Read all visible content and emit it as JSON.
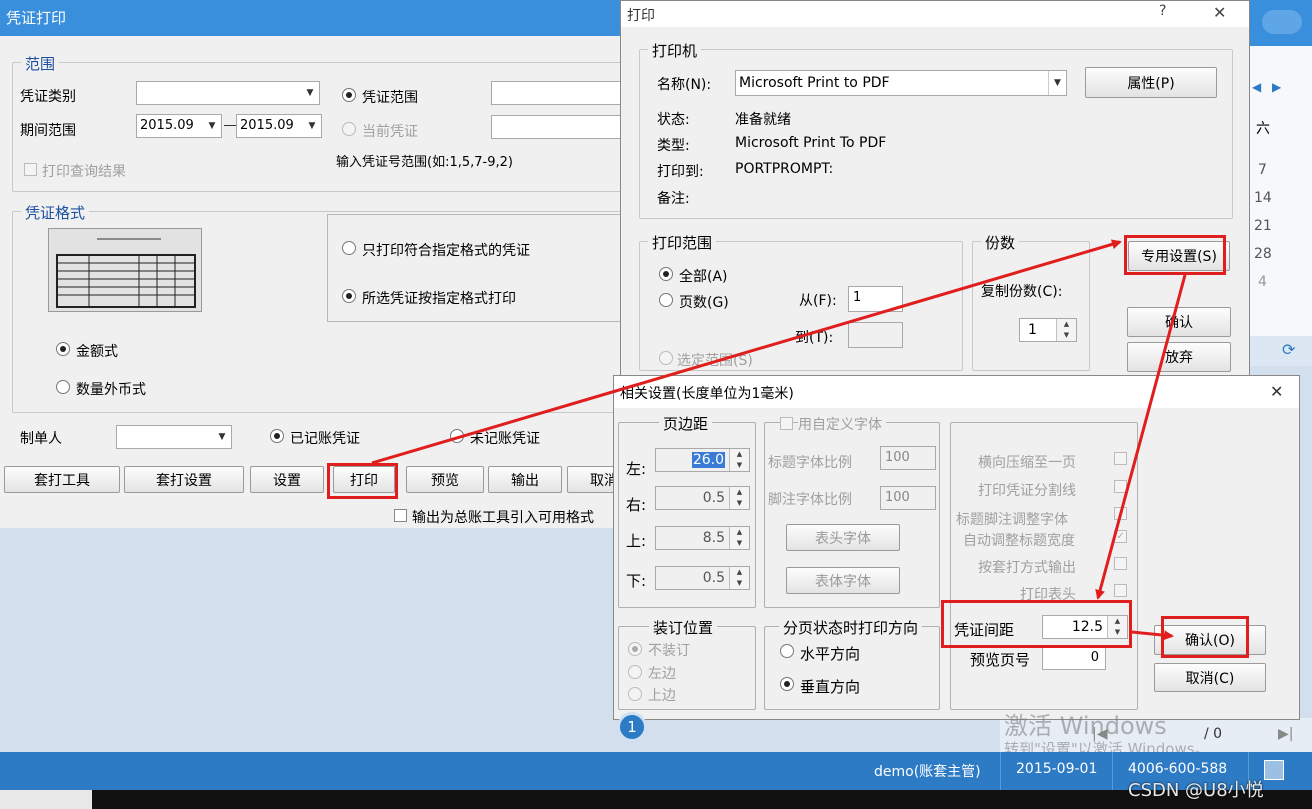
{
  "voucher_window": {
    "title": "凭证打印",
    "range_group": "范围",
    "voucher_type_label": "凭证类别",
    "period_label": "期间范围",
    "period_from": "2015.09",
    "period_to": "2015.09",
    "print_query_result": "打印查询结果",
    "voucher_range_radio": "凭证范围",
    "current_voucher_radio": "当前凭证",
    "voucher_range_hint": "输入凭证号范围(如:1,5,7-9,2)",
    "format_group": "凭证格式",
    "format_option1": "只打印符合指定格式的凭证",
    "format_option2": "所选凭证按指定格式打印",
    "amount_format": "金额式",
    "qty_format": "数量外币式",
    "maker_label": "制单人",
    "posted_voucher": "已记账凭证",
    "unposted_voucher": "未记账凭证",
    "buttons": [
      "套打工具",
      "套打设置",
      "设置",
      "打印",
      "预览",
      "输出",
      "取消"
    ],
    "export_checkbox": "输出为总账工具引入可用格式"
  },
  "print_dialog": {
    "title": "打印",
    "help": "?",
    "close": "✕",
    "printer_group": "打印机",
    "name_label": "名称(N):",
    "printer_name": "Microsoft Print to PDF",
    "properties_button": "属性(P)",
    "status_label": "状态:",
    "status_value": "准备就绪",
    "type_label": "类型:",
    "type_value": "Microsoft Print To PDF",
    "where_label": "打印到:",
    "where_value": "PORTPROMPT:",
    "comment_label": "备注:",
    "range_group": "打印范围",
    "all_radio": "全部(A)",
    "pages_radio": "页数(G)",
    "from_label": "从(F):",
    "from_value": "1",
    "to_label": "到(T):",
    "selection_radio": "选定范围(S)",
    "copies_group": "份数",
    "copies_label": "复制份数(C):",
    "copies_value": "1",
    "special_settings_button": "专用设置(S)",
    "ok_button": "确认",
    "cancel_button": "放弃"
  },
  "settings_dialog": {
    "title": "相关设置(长度单位为1毫米)",
    "close": "✕",
    "margin_group": "页边距",
    "left_label": "左:",
    "left_value": "26.0",
    "right_label": "右:",
    "right_value": "0.5",
    "top_label": "上:",
    "top_value": "8.5",
    "bottom_label": "下:",
    "bottom_value": "0.5",
    "custom_font_checkbox": "用自定义字体",
    "title_font_ratio_label": "标题字体比例",
    "title_font_ratio_value": "100",
    "footnote_font_ratio_label": "脚注字体比例",
    "footnote_font_ratio_value": "100",
    "header_font_button": "表头字体",
    "body_font_button": "表体字体",
    "options": [
      "横向压缩至一页",
      "打印凭证分割线",
      "标题脚注调整字体",
      "自动调整标题宽度",
      "按套打方式输出",
      "打印表头"
    ],
    "binding_group": "装订位置",
    "binding_options": [
      "不装订",
      "左边",
      "上边"
    ],
    "direction_group": "分页状态时打印方向",
    "horizontal": "水平方向",
    "vertical": "垂直方向",
    "spacing_label": "凭证间距",
    "spacing_value": "12.5",
    "preview_page_label": "预览页号",
    "preview_page_value": "0",
    "ok_button": "确认(O)",
    "cancel_button": "取消(C)"
  },
  "background": {
    "calendar_header": "六",
    "calendar_days": [
      "7",
      "14",
      "21",
      "28",
      "4"
    ],
    "page_indicator": "1",
    "page_total": "/ 0"
  },
  "watermark": {
    "line1": "激活 Windows",
    "line2": "转到\"设置\"以激活 Windows。"
  },
  "statusbar": {
    "user": "demo(账套主管)",
    "date": "2015-09-01",
    "phone": "4006-600-588"
  },
  "csdn_mark": "CSDN @U8小悦",
  "colors": {
    "title_blue": "#3a8fdc",
    "status_blue": "#2d7bc4",
    "highlight_red": "#e01e1e"
  }
}
